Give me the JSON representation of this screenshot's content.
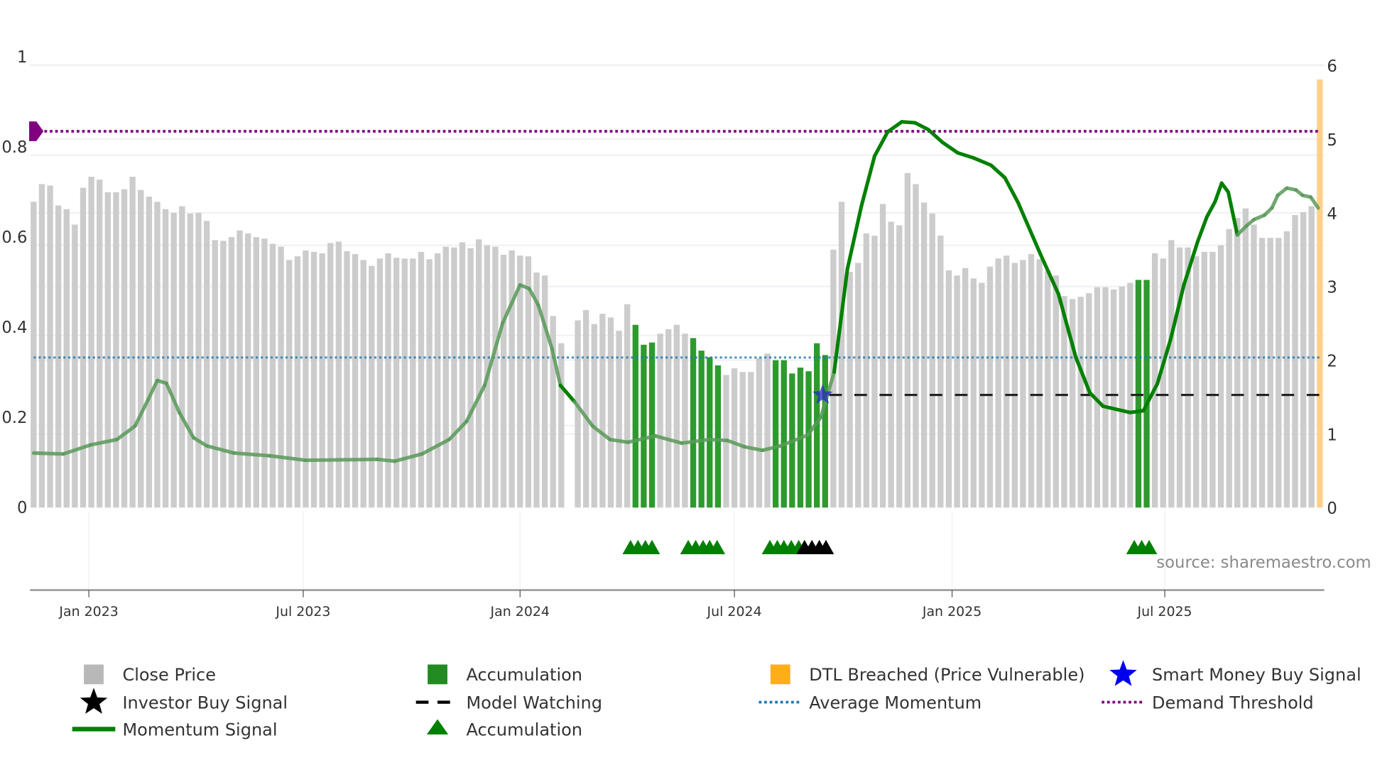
{
  "chart_data": {
    "type": "bar+line",
    "title": "",
    "frequency": "weekly",
    "left_axis": {
      "ylim": [
        0,
        1
      ],
      "ticks": [
        "0",
        "0.2",
        "0.4",
        "0.6",
        "0.8",
        "1"
      ]
    },
    "right_axis": {
      "ylim": [
        0,
        6
      ],
      "ticks": [
        "0",
        "1",
        "2",
        "3",
        "4",
        "5",
        "6"
      ]
    },
    "x_ticks": [
      {
        "label": "Jan 2023",
        "index": 6.7
      },
      {
        "label": "Jul 2023",
        "index": 32.7
      },
      {
        "label": "Jan 2024",
        "index": 59.0
      },
      {
        "label": "Jul 2024",
        "index": 85.0
      },
      {
        "label": "Jan 2025",
        "index": 111.4
      },
      {
        "label": "Jul 2025",
        "index": 137.2
      }
    ],
    "close_price": [
      4.15,
      4.39,
      4.37,
      4.1,
      4.05,
      3.84,
      4.34,
      4.49,
      4.45,
      4.28,
      4.28,
      4.32,
      4.49,
      4.31,
      4.22,
      4.15,
      4.05,
      4.0,
      4.09,
      3.99,
      4.0,
      3.89,
      3.63,
      3.62,
      3.67,
      3.76,
      3.72,
      3.67,
      3.65,
      3.58,
      3.54,
      3.36,
      3.41,
      3.49,
      3.47,
      3.45,
      3.59,
      3.61,
      3.48,
      3.44,
      3.36,
      3.28,
      3.38,
      3.45,
      3.39,
      3.38,
      3.38,
      3.47,
      3.37,
      3.45,
      3.54,
      3.53,
      3.6,
      3.52,
      3.64,
      3.56,
      3.54,
      3.43,
      3.49,
      3.42,
      3.41,
      3.19,
      3.15,
      2.6,
      2.23,
      null,
      2.54,
      2.68,
      2.49,
      2.63,
      2.58,
      2.4,
      2.76,
      2.48,
      2.21,
      2.24,
      2.36,
      2.42,
      2.48,
      2.36,
      2.3,
      2.13,
      2.04,
      1.93,
      1.8,
      1.89,
      1.84,
      1.84,
      2.03,
      2.09,
      2.0,
      2.0,
      1.82,
      1.9,
      1.85,
      2.23,
      2.07,
      3.5,
      4.15,
      3.2,
      3.32,
      3.72,
      3.69,
      4.12,
      3.88,
      3.83,
      4.54,
      4.39,
      4.14,
      3.99,
      3.69,
      3.22,
      3.15,
      3.25,
      3.11,
      3.05,
      3.27,
      3.38,
      3.42,
      3.32,
      3.36,
      3.44,
      3.37,
      3.21,
      3.15,
      2.87,
      2.83,
      2.86,
      2.91,
      2.99,
      2.99,
      2.96,
      3.0,
      3.05,
      3.09,
      3.09,
      3.45,
      3.38,
      3.63,
      3.53,
      3.53,
      3.41,
      3.47,
      3.47,
      3.56,
      3.78,
      3.93,
      4.06,
      3.84,
      3.66,
      3.66,
      3.66,
      3.75,
      3.97,
      4.01,
      4.09,
      5.81
    ],
    "accumulation_bar_indices": [
      73,
      74,
      75,
      80,
      81,
      82,
      83,
      90,
      91,
      92,
      93,
      94,
      95,
      96,
      134,
      135
    ],
    "dtl_breached_bar_indices": [
      156
    ],
    "momentum_signal": [
      [
        0,
        0.121
      ],
      [
        3.6,
        0.119
      ],
      [
        6.9,
        0.139
      ],
      [
        10.1,
        0.151
      ],
      [
        12.3,
        0.181
      ],
      [
        13.9,
        0.24
      ],
      [
        15,
        0.282
      ],
      [
        16.1,
        0.276
      ],
      [
        17.7,
        0.21
      ],
      [
        19.4,
        0.155
      ],
      [
        21,
        0.137
      ],
      [
        24.3,
        0.121
      ],
      [
        28.6,
        0.115
      ],
      [
        33,
        0.105
      ],
      [
        41.7,
        0.107
      ],
      [
        43.8,
        0.103
      ],
      [
        47.1,
        0.119
      ],
      [
        50.4,
        0.151
      ],
      [
        52.5,
        0.191
      ],
      [
        54.7,
        0.271
      ],
      [
        56.9,
        0.41
      ],
      [
        59,
        0.494
      ],
      [
        60.1,
        0.486
      ],
      [
        61.2,
        0.45
      ],
      [
        62.9,
        0.351
      ],
      [
        63.9,
        0.271
      ],
      [
        65.6,
        0.235
      ],
      [
        67.8,
        0.181
      ],
      [
        69.9,
        0.151
      ],
      [
        72.1,
        0.145
      ],
      [
        75.4,
        0.159
      ],
      [
        78.6,
        0.143
      ],
      [
        81.9,
        0.151
      ],
      [
        84.1,
        0.149
      ],
      [
        86.2,
        0.135
      ],
      [
        88.4,
        0.127
      ],
      [
        90.6,
        0.137
      ],
      [
        93.9,
        0.161
      ],
      [
        95.5,
        0.201
      ],
      [
        97.1,
        0.301
      ],
      [
        98.7,
        0.529
      ],
      [
        100.4,
        0.669
      ],
      [
        102,
        0.78
      ],
      [
        103.6,
        0.834
      ],
      [
        105.3,
        0.856
      ],
      [
        106.9,
        0.854
      ],
      [
        108.5,
        0.839
      ],
      [
        110.2,
        0.811
      ],
      [
        112.1,
        0.787
      ],
      [
        114,
        0.776
      ],
      [
        116.1,
        0.76
      ],
      [
        117.8,
        0.732
      ],
      [
        119.4,
        0.677
      ],
      [
        122.1,
        0.563
      ],
      [
        124.3,
        0.474
      ],
      [
        126.4,
        0.334
      ],
      [
        128.1,
        0.255
      ],
      [
        129.7,
        0.225
      ],
      [
        133,
        0.211
      ],
      [
        134.6,
        0.215
      ],
      [
        136.3,
        0.275
      ],
      [
        137.9,
        0.373
      ],
      [
        139.5,
        0.493
      ],
      [
        141.2,
        0.591
      ],
      [
        142.3,
        0.645
      ],
      [
        143.3,
        0.679
      ],
      [
        144.1,
        0.72
      ],
      [
        144.9,
        0.7
      ],
      [
        146,
        0.605
      ],
      [
        147.1,
        0.625
      ],
      [
        148,
        0.639
      ],
      [
        149.3,
        0.649
      ],
      [
        150.2,
        0.665
      ],
      [
        150.9,
        0.693
      ],
      [
        152,
        0.709
      ],
      [
        153.1,
        0.705
      ],
      [
        153.9,
        0.693
      ],
      [
        154.9,
        0.689
      ],
      [
        155.8,
        0.665
      ]
    ],
    "momentum_strong_ranges": [
      [
        63.5,
        66
      ],
      [
        97,
        145.5
      ]
    ],
    "average_momentum": 0.333,
    "demand_threshold": 0.835,
    "model_watching": {
      "value": 0.25,
      "from_index": 96.5,
      "to_index": 156
    },
    "smart_money_buy_signal": [
      {
        "index": 95.7,
        "value": 0.25
      }
    ],
    "accumulation_markers": [
      72.4,
      73.3,
      74.2,
      75.0,
      79.4,
      80.3,
      81.2,
      82.0,
      82.9,
      89.3,
      90.2,
      91.0,
      91.9,
      92.8,
      133.5,
      134.4,
      135.3
    ],
    "investor_buy_markers": [
      93.5,
      94.4,
      95.3,
      96.1
    ],
    "legend": [
      {
        "label": "Close Price",
        "symbol": "square",
        "color": "#b8b8b8"
      },
      {
        "label": "Accumulation",
        "symbol": "square",
        "color": "#228b22"
      },
      {
        "label": "DTL Breached (Price Vulnerable)",
        "symbol": "square",
        "color": "#ffae1a"
      },
      {
        "label": "Smart Money Buy Signal",
        "symbol": "star",
        "color": "#0000ee"
      },
      {
        "label": "Investor Buy Signal",
        "symbol": "star",
        "color": "#000000"
      },
      {
        "label": "Model Watching",
        "symbol": "dash",
        "color": "#000000"
      },
      {
        "label": "Average Momentum",
        "symbol": "dot",
        "color": "#1f77b4"
      },
      {
        "label": "Demand Threshold",
        "symbol": "dot",
        "color": "#800080"
      },
      {
        "label": "Momentum Signal",
        "symbol": "line",
        "color": "#008000"
      },
      {
        "label": "Accumulation",
        "symbol": "triangle",
        "color": "#008000"
      }
    ],
    "legend_placement": "bottom"
  },
  "source": "source: sharemaestro.com",
  "colors": {
    "price": "#cccccc",
    "accumulation": "#2e9a2e",
    "dtl": "#ffd08a",
    "momentum_strong": "#008000",
    "momentum_weak": "#5a9a5a",
    "avg": "#1f77b4",
    "threshold": "#800080",
    "grid": "#eef0f3",
    "axis": "#9a9a9a"
  }
}
